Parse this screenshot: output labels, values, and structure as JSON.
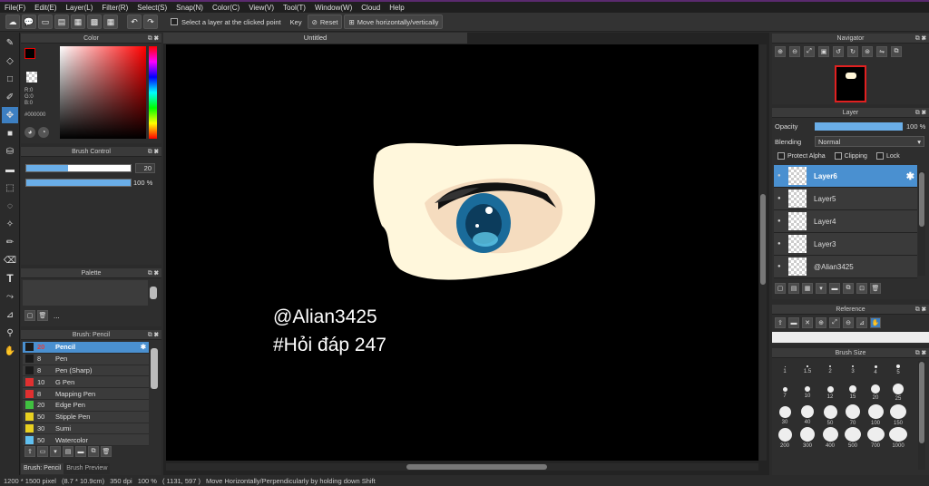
{
  "menu": [
    "File(F)",
    "Edit(E)",
    "Layer(L)",
    "Filter(R)",
    "Select(S)",
    "Snap(N)",
    "Color(C)",
    "View(V)",
    "Tool(T)",
    "Window(W)",
    "Cloud",
    "Help"
  ],
  "toolbar": {
    "select_layer_label": "Select a layer at the clicked point",
    "key_label": "Key",
    "reset_label": "Reset",
    "move_label": "Move horizontally/vertically"
  },
  "document": {
    "title": "Untitled"
  },
  "color_panel": {
    "title": "Color",
    "r": "R:0",
    "g": "G:0",
    "b": "B:0",
    "hex": "#000000",
    "primary": "#000000",
    "secondary": "#ff6a00"
  },
  "brush_control": {
    "title": "Brush Control",
    "size": "20",
    "opacity": "100 %"
  },
  "palette": {
    "title": "Palette",
    "more": "..."
  },
  "brush_list": {
    "title": "Brush: Pencil",
    "items": [
      {
        "size": "20",
        "name": "Pencil",
        "color": "#1a1a1a"
      },
      {
        "size": "8",
        "name": "Pen",
        "color": "#1a1a1a"
      },
      {
        "size": "8",
        "name": "Pen (Sharp)",
        "color": "#1a1a1a"
      },
      {
        "size": "10",
        "name": "G Pen",
        "color": "#e03030"
      },
      {
        "size": "8",
        "name": "Mapping Pen",
        "color": "#e03030"
      },
      {
        "size": "20",
        "name": "Edge Pen",
        "color": "#40c040"
      },
      {
        "size": "50",
        "name": "Stipple Pen",
        "color": "#e8d020"
      },
      {
        "size": "30",
        "name": "Sumi",
        "color": "#e8d020"
      },
      {
        "size": "50",
        "name": "Watercolor",
        "color": "#60c0f0"
      }
    ],
    "tab1": "Brush: Pencil",
    "tab2": "Brush Preview"
  },
  "canvas_text": {
    "line1": "@Alian3425",
    "line2": "#Hỏi đáp 247"
  },
  "navigator": {
    "title": "Navigator"
  },
  "layer_panel": {
    "title": "Layer",
    "opacity_label": "Opacity",
    "opacity_value": "100 %",
    "blending_label": "Blending",
    "blending_value": "Normal",
    "protect_alpha": "Protect Alpha",
    "clipping": "Clipping",
    "lock": "Lock",
    "layers": [
      {
        "name": "Layer6",
        "selected": true
      },
      {
        "name": "Layer5",
        "selected": false
      },
      {
        "name": "Layer4",
        "selected": false
      },
      {
        "name": "Layer3",
        "selected": false
      },
      {
        "name": "@Alian3425",
        "selected": false
      }
    ]
  },
  "reference": {
    "title": "Reference"
  },
  "brush_size": {
    "title": "Brush Size",
    "sizes": [
      "1",
      "1.5",
      "2",
      "3",
      "4",
      "5",
      "7",
      "10",
      "12",
      "15",
      "20",
      "25",
      "30",
      "40",
      "50",
      "70",
      "100",
      "150",
      "200",
      "300",
      "400",
      "500",
      "700",
      "1000"
    ]
  },
  "status": {
    "dims": "1200 * 1500 pixel",
    "cm": "(8.7 * 10.9cm)",
    "dpi": "350 dpi",
    "zoom": "100 %",
    "coords": "( 1131, 597 )",
    "hint": "Move Horizontally/Perpendicularly by holding down Shift"
  }
}
